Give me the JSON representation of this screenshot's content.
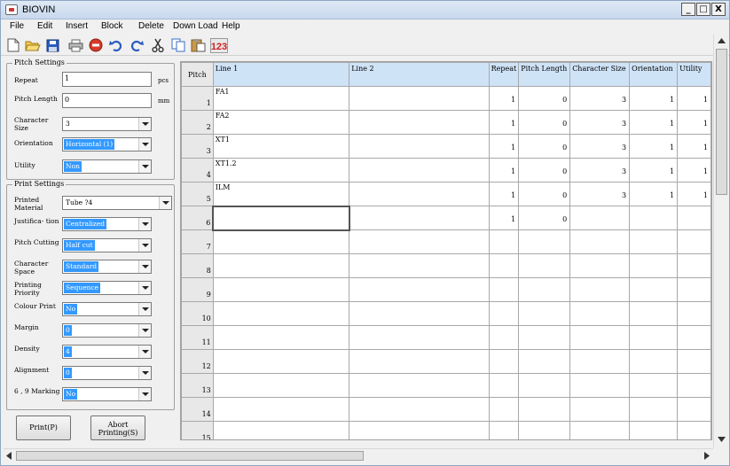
{
  "window": {
    "title": "BIOVIN",
    "minimize": "_",
    "maximize": "□",
    "close": "X"
  },
  "menu": [
    "File",
    "Edit",
    "Insert",
    "Block",
    "Delete",
    "Down Load",
    "Help"
  ],
  "toolbar": {
    "icons": [
      "new-file-icon",
      "open-folder-icon",
      "save-icon",
      "print-icon",
      "stop-icon",
      "undo-icon",
      "redo-icon",
      "cut-icon",
      "copy-icon",
      "paste-icon",
      "numbering-icon"
    ],
    "numbering_glyph": "123"
  },
  "pitch_settings": {
    "title": "Pitch Settings",
    "repeat": {
      "label": "Repeat",
      "value": "1",
      "unit": "pcs"
    },
    "pitch_length": {
      "label": "Pitch Length",
      "value": "0",
      "unit": "mm"
    },
    "character_size": {
      "label": "Character Size",
      "value": "3"
    },
    "orientation": {
      "label": "Orientation",
      "value": "Horizontal (1)"
    },
    "utility": {
      "label": "Utility",
      "value": "Non"
    }
  },
  "print_settings": {
    "title": "Print Settings",
    "printed_material": {
      "label": "Printed Material",
      "value": "Tube ?4"
    },
    "justification": {
      "label": "Justifica- tion",
      "value": "Centralized"
    },
    "pitch_cutting": {
      "label": "Pitch Cutting",
      "value": "Half cut"
    },
    "character_space": {
      "label": "Character Space",
      "value": "Standard"
    },
    "printing_priority": {
      "label": "Printing Priority",
      "value": "Sequence"
    },
    "colour_print": {
      "label": "Colour Print",
      "value": "No"
    },
    "margin": {
      "label": "Margin",
      "value": "0"
    },
    "density": {
      "label": "Density",
      "value": "4"
    },
    "alignment": {
      "label": "Alignment",
      "value": "0"
    },
    "marking": {
      "label": "6 , 9 Marking",
      "value": "No"
    }
  },
  "buttons": {
    "print": "Print(P)",
    "abort": "Abort Printing(S)"
  },
  "grid": {
    "columns": [
      "Pitch",
      "Line 1",
      "Line 2",
      "Repeat",
      "Pitch Length",
      "Character Size",
      "Orientation",
      "Utility"
    ],
    "rows": [
      {
        "pitch": "1",
        "line1": "FA1",
        "line2": "",
        "repeat": "1",
        "pitch_length": "0",
        "char_size": "3",
        "orientation": "1",
        "utility": "1"
      },
      {
        "pitch": "2",
        "line1": "FA2",
        "line2": "",
        "repeat": "1",
        "pitch_length": "0",
        "char_size": "3",
        "orientation": "1",
        "utility": "1"
      },
      {
        "pitch": "3",
        "line1": "XT1",
        "line2": "",
        "repeat": "1",
        "pitch_length": "0",
        "char_size": "3",
        "orientation": "1",
        "utility": "1"
      },
      {
        "pitch": "4",
        "line1": "XT1.2",
        "line2": "",
        "repeat": "1",
        "pitch_length": "0",
        "char_size": "3",
        "orientation": "1",
        "utility": "1"
      },
      {
        "pitch": "5",
        "line1": "ILM",
        "line2": "",
        "repeat": "1",
        "pitch_length": "0",
        "char_size": "3",
        "orientation": "1",
        "utility": "1"
      },
      {
        "pitch": "6",
        "line1": "",
        "line2": "",
        "repeat": "1",
        "pitch_length": "0",
        "char_size": "",
        "orientation": "",
        "utility": ""
      },
      {
        "pitch": "7",
        "line1": "",
        "line2": "",
        "repeat": "",
        "pitch_length": "",
        "char_size": "",
        "orientation": "",
        "utility": ""
      },
      {
        "pitch": "8",
        "line1": "",
        "line2": "",
        "repeat": "",
        "pitch_length": "",
        "char_size": "",
        "orientation": "",
        "utility": ""
      },
      {
        "pitch": "9",
        "line1": "",
        "line2": "",
        "repeat": "",
        "pitch_length": "",
        "char_size": "",
        "orientation": "",
        "utility": ""
      },
      {
        "pitch": "10",
        "line1": "",
        "line2": "",
        "repeat": "",
        "pitch_length": "",
        "char_size": "",
        "orientation": "",
        "utility": ""
      },
      {
        "pitch": "11",
        "line1": "",
        "line2": "",
        "repeat": "",
        "pitch_length": "",
        "char_size": "",
        "orientation": "",
        "utility": ""
      },
      {
        "pitch": "12",
        "line1": "",
        "line2": "",
        "repeat": "",
        "pitch_length": "",
        "char_size": "",
        "orientation": "",
        "utility": ""
      },
      {
        "pitch": "13",
        "line1": "",
        "line2": "",
        "repeat": "",
        "pitch_length": "",
        "char_size": "",
        "orientation": "",
        "utility": ""
      },
      {
        "pitch": "14",
        "line1": "",
        "line2": "",
        "repeat": "",
        "pitch_length": "",
        "char_size": "",
        "orientation": "",
        "utility": ""
      },
      {
        "pitch": "15",
        "line1": "",
        "line2": "",
        "repeat": "",
        "pitch_length": "",
        "char_size": "",
        "orientation": "",
        "utility": ""
      }
    ]
  }
}
